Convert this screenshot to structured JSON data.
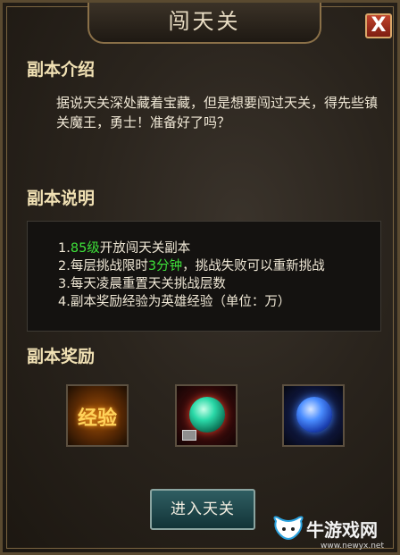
{
  "window": {
    "title": "闯天关",
    "close_label": "X"
  },
  "intro": {
    "heading": "副本介绍",
    "text": "据说天关深处藏着宝藏，但是想要闯过天关，得先些镇关魔王，勇士！准备好了吗？"
  },
  "rules": {
    "heading": "副本说明",
    "items": [
      {
        "prefix": "1.",
        "highlight": "85级",
        "rest": "开放闯天关副本"
      },
      {
        "prefix": "2.每层挑战限时",
        "highlight": "3分钟",
        "rest": "，挑战失败可以重新挑战"
      },
      {
        "prefix": "3.每天凌晨重置天关挑战层数",
        "highlight": "",
        "rest": ""
      },
      {
        "prefix": "4.副本奖励经验为英雄经验（单位：万）",
        "highlight": "",
        "rest": ""
      }
    ],
    "highlight_color": "#3ee23a"
  },
  "rewards": {
    "heading": "副本奖励",
    "items": [
      {
        "name": "经验",
        "icon": "exp-icon"
      },
      {
        "name": "",
        "icon": "green-orb-icon"
      },
      {
        "name": "",
        "icon": "blue-orb-icon"
      }
    ]
  },
  "enter_button": {
    "label": "进入天关"
  },
  "watermark": {
    "text": "牛游戏网",
    "url": "www.newyx.net"
  }
}
